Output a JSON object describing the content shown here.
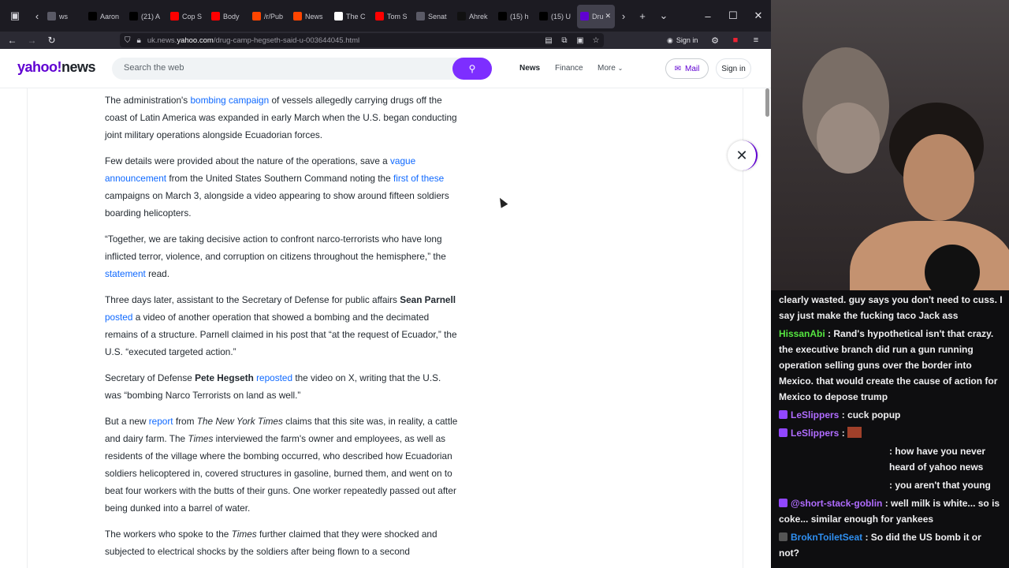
{
  "browser": {
    "tabs": [
      {
        "title": "ws",
        "icon": "tab-icon",
        "color": "#5a5a66"
      },
      {
        "title": "Aaron",
        "icon": "x-icon",
        "color": "#000000"
      },
      {
        "title": "(21) A",
        "icon": "x-icon",
        "color": "#000000"
      },
      {
        "title": "Cop S",
        "icon": "youtube-icon",
        "color": "#ff0000"
      },
      {
        "title": "Body",
        "icon": "youtube-icon",
        "color": "#ff0000"
      },
      {
        "title": "/r/Pub",
        "icon": "reddit-icon",
        "color": "#ff4500"
      },
      {
        "title": "News",
        "icon": "reddit-icon",
        "color": "#ff4500"
      },
      {
        "title": "The C",
        "icon": "w-icon",
        "color": "#ffffff"
      },
      {
        "title": "Tom S",
        "icon": "youtube-icon",
        "color": "#ff0000"
      },
      {
        "title": "Senat",
        "icon": "tab-icon",
        "color": "#5a5a66"
      },
      {
        "title": "Ahrek",
        "icon": "tiktok-icon",
        "color": "#111111"
      },
      {
        "title": "(15) h",
        "icon": "x-icon",
        "color": "#000000"
      },
      {
        "title": "(15) U",
        "icon": "x-icon",
        "color": "#000000"
      },
      {
        "title": "Dru",
        "icon": "yahoo-icon",
        "color": "#6001d2",
        "active": true
      }
    ],
    "url_prefix": "uk.news.",
    "url_domain": "yahoo.com",
    "url_path": "/drug-camp-hegseth-said-u-003644045.html",
    "signin_label": "Sign in"
  },
  "yahoo": {
    "logo_main": "yahoo!",
    "logo_news": "news",
    "search_placeholder": "Search the web",
    "nav": {
      "news": "News",
      "finance": "Finance",
      "more": "More"
    },
    "mail_label": "Mail",
    "signin_label": "Sign in"
  },
  "article": {
    "p1": {
      "a": "The administration's ",
      "link": "bombing campaign",
      "b": " of vessels allegedly carrying drugs off the coast of Latin America was expanded in early March when the U.S. began conducting joint military operations alongside Ecuadorian forces."
    },
    "p2": {
      "a": "Few details were provided about the nature of the operations, save a ",
      "link1": "vague announcement",
      "b": " from the United States Southern Command noting the ",
      "link2": "first of these",
      "c": " campaigns on March 3, alongside a video appearing to show around fifteen soldiers boarding helicopters."
    },
    "p3": {
      "a": "“Together, we are taking decisive action to confront narco-terrorists who have long inflicted terror, violence, and corruption on citizens throughout the hemisphere,” the ",
      "link": "statement",
      "b": " read."
    },
    "p4": {
      "a": "Three days later, assistant to the Secretary of Defense for public affairs ",
      "name": "Sean Parnell",
      "link": "posted",
      "b": " a video of another operation that showed a bombing and the decimated remains of a structure. Parnell claimed in his post that “at the request of Ecuador,” the U.S. “executed targeted action.”"
    },
    "p5": {
      "a": "Secretary of Defense ",
      "name": "Pete Hegseth",
      "link": "reposted",
      "b": " the video on X, writing that the U.S. was “bombing Narco Terrorists on land as well.”"
    },
    "p6": {
      "a": "But a new ",
      "link": "report",
      "b": " from ",
      "italic1": "The New York Times",
      "c": " claims that this site was, in reality, a cattle and dairy farm. The ",
      "italic2": "Times",
      "d": " interviewed the farm's owner and employees, as well as residents of the village where the bombing occurred, who described how Ecuadorian soldiers helicoptered in, covered structures in gasoline, burned them, and went on to beat four workers with the butts of their guns. One worker repeatedly passed out after being dunked into a barrel of water."
    },
    "p7": {
      "a": "The workers who spoke to the ",
      "italic": "Times",
      "b": " further claimed that they were shocked and subjected to electrical shocks by the soldiers after being flown to a second"
    }
  },
  "chat": {
    "messages": [
      {
        "user": "",
        "text": "clearly wasted. guy says you don't need to cuss. I say just make the fucking taco Jack ass",
        "color": "#efeff1"
      },
      {
        "user": "HissanAbi",
        "text": "Rand's hypothetical isn't that crazy. the executive branch did run a gun running operation selling guns over the border into Mexico. that would create the cause of action for Mexico to depose trump",
        "color": "#55e640"
      },
      {
        "user": "LeSlippers",
        "text": "cuck popup",
        "color": "#b06cff"
      },
      {
        "user": "LeSlippers",
        "text": "",
        "color": "#b06cff",
        "emote": true
      },
      {
        "user": "",
        "text": ": how have you never heard of yahoo news",
        "color": "#efeff1",
        "indent": true
      },
      {
        "user": "",
        "text": ": you aren't that young",
        "color": "#efeff1",
        "indent": true
      },
      {
        "user": "@short-stack-goblin",
        "text": "well milk is white... so is coke... similar enough for yankees",
        "color": "#b06cff"
      },
      {
        "user": "BroknToiletSeat",
        "text": "So did the US bomb it or not?",
        "color": "#2f8ff0"
      }
    ]
  }
}
